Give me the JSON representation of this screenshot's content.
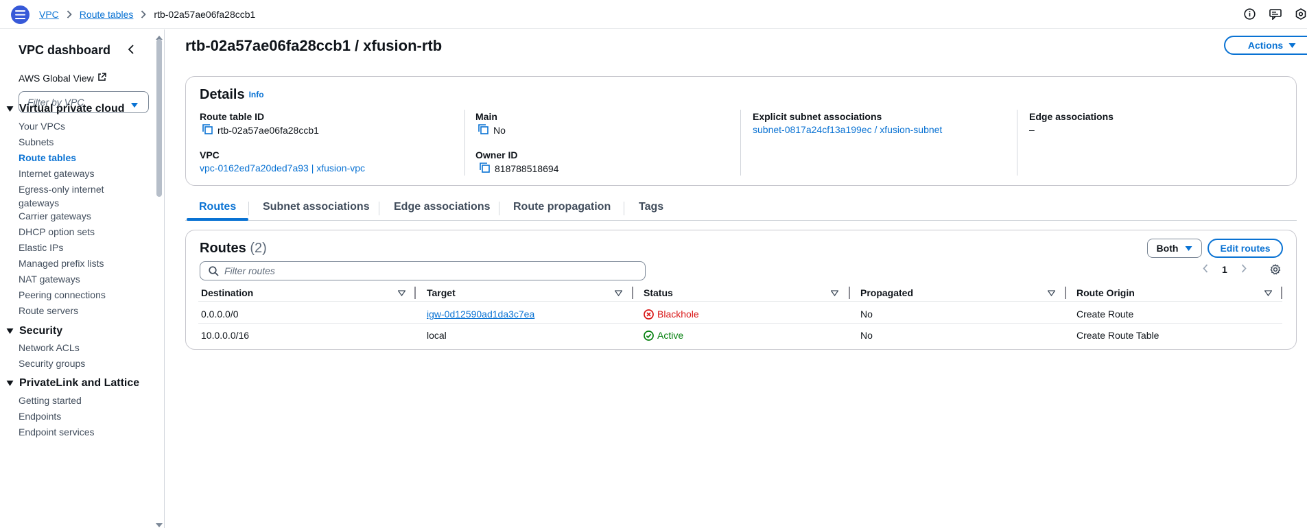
{
  "breadcrumb": {
    "items": [
      "VPC",
      "Route tables"
    ],
    "current": "rtb-02a57ae06fa28ccb1"
  },
  "sidebar": {
    "title": "VPC dashboard",
    "global_view": "AWS Global View",
    "filter_placeholder": "Filter by VPC",
    "sections": [
      {
        "label": "Virtual private cloud",
        "items": [
          "Your VPCs",
          "Subnets",
          "Route tables",
          "Internet gateways",
          "Egress-only internet gateways",
          "Carrier gateways",
          "DHCP option sets",
          "Elastic IPs",
          "Managed prefix lists",
          "NAT gateways",
          "Peering connections",
          "Route servers"
        ]
      },
      {
        "label": "Security",
        "items": [
          "Network ACLs",
          "Security groups"
        ]
      },
      {
        "label": "PrivateLink and Lattice",
        "items": [
          "Getting started",
          "Endpoints",
          "Endpoint services"
        ]
      }
    ],
    "active_item": "Route tables"
  },
  "page": {
    "title": "rtb-02a57ae06fa28ccb1 / xfusion-rtb",
    "actions_label": "Actions"
  },
  "details": {
    "title": "Details",
    "info": "Info",
    "route_table_id_label": "Route table ID",
    "route_table_id": "rtb-02a57ae06fa28ccb1",
    "main_label": "Main",
    "main": "No",
    "explicit_label": "Explicit subnet associations",
    "explicit": "subnet-0817a24cf13a199ec / xfusion-subnet",
    "edge_label": "Edge associations",
    "edge": "–",
    "vpc_label": "VPC",
    "vpc": "vpc-0162ed7a20ded7a93 | xfusion-vpc",
    "owner_label": "Owner ID",
    "owner": "818788518694"
  },
  "tabs": [
    "Routes",
    "Subnet associations",
    "Edge associations",
    "Route propagation",
    "Tags"
  ],
  "routes": {
    "title": "Routes",
    "count": "(2)",
    "both_label": "Both",
    "edit_label": "Edit routes",
    "search_placeholder": "Filter routes",
    "page": "1",
    "columns": [
      "Destination",
      "Target",
      "Status",
      "Propagated",
      "Route Origin"
    ],
    "rows": [
      {
        "destination": "0.0.0.0/0",
        "target": "igw-0d12590ad1da3c7ea",
        "status": "Blackhole",
        "propagated": "No",
        "origin": "Create Route"
      },
      {
        "destination": "10.0.0.0/16",
        "target": "local",
        "status": "Active",
        "propagated": "No",
        "origin": "Create Route Table"
      }
    ]
  },
  "colors": {
    "accent": "#0972d3",
    "error": "#d91515",
    "success": "#037f0c"
  }
}
